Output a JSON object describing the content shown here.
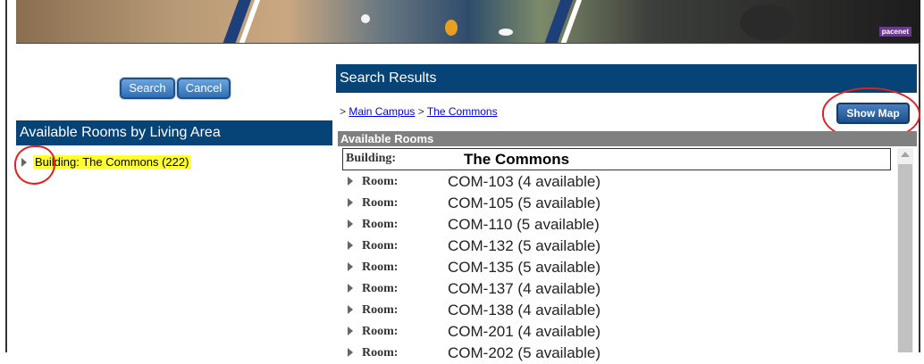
{
  "search_panel": {
    "search_label": "Search",
    "cancel_label": "Cancel",
    "header": "Available Rooms by Living Area",
    "tree": [
      {
        "label": "Building: The Commons (222)"
      }
    ]
  },
  "results": {
    "header": "Search Results",
    "breadcrumb": {
      "prefix": ">",
      "items": [
        "Main Campus",
        "The Commons"
      ],
      "separator": ">"
    },
    "show_map_label": "Show Map",
    "section_header": "Available Rooms",
    "building": {
      "label": "Building:",
      "value": "The Commons"
    },
    "rooms": [
      {
        "label": "Room:",
        "value": "COM-103 (4 available)"
      },
      {
        "label": "Room:",
        "value": "COM-105 (5 available)"
      },
      {
        "label": "Room:",
        "value": "COM-110 (5 available)"
      },
      {
        "label": "Room:",
        "value": "COM-132 (5 available)"
      },
      {
        "label": "Room:",
        "value": "COM-135 (5 available)"
      },
      {
        "label": "Room:",
        "value": "COM-137 (4 available)"
      },
      {
        "label": "Room:",
        "value": "COM-138 (4 available)"
      },
      {
        "label": "Room:",
        "value": "COM-201 (4 available)"
      },
      {
        "label": "Room:",
        "value": "COM-202 (5 available)"
      }
    ]
  },
  "colors": {
    "header_blue": "#064477",
    "highlight": "#ffff33",
    "annotation_red": "#dd2222"
  }
}
